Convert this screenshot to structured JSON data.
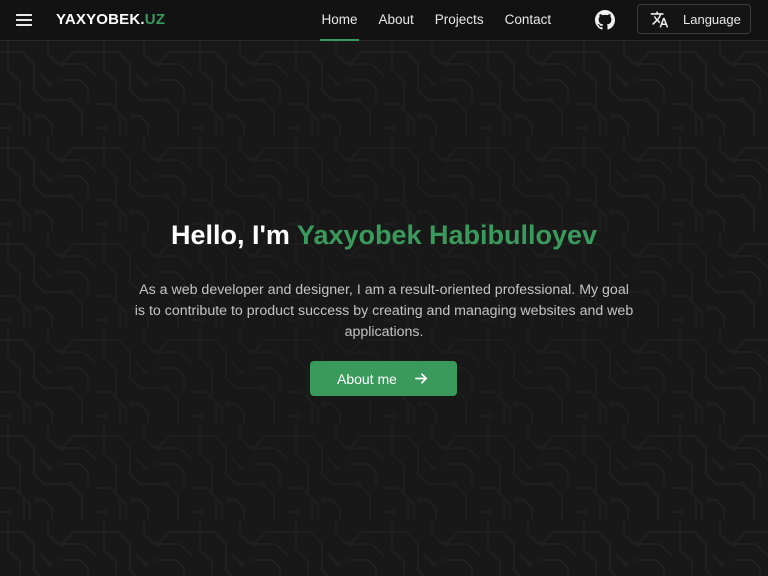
{
  "header": {
    "menu_icon": "hamburger-menu-icon",
    "brand": {
      "name": "YAXYOBEK",
      "dot": ".",
      "tld": "UZ"
    },
    "nav": [
      {
        "label": "Home",
        "active": true
      },
      {
        "label": "About",
        "active": false
      },
      {
        "label": "Projects",
        "active": false
      },
      {
        "label": "Contact",
        "active": false
      }
    ],
    "github_icon": "github-icon",
    "language": {
      "icon": "translate-icon",
      "label": "Language"
    }
  },
  "hero": {
    "greeting": "Hello, I'm",
    "name": "Yaxyobek Habibulloyev",
    "description": "As a web developer and designer, I am a result-oriented professional. My goal is to contribute to product success by creating and managing websites and web applications.",
    "button": {
      "label": "About me",
      "icon": "arrow-right-icon"
    }
  },
  "colors": {
    "accent": "#3a9a5c",
    "background": "#181818",
    "header_bg": "#121212",
    "text": "#ffffff",
    "muted_text": "#c4c4c4"
  }
}
